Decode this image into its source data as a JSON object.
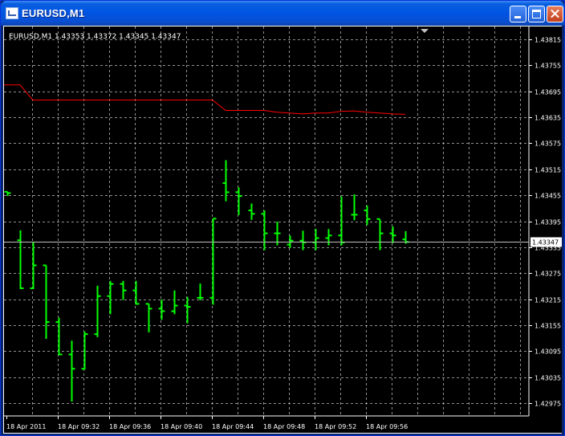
{
  "window": {
    "title": "EURUSD,M1",
    "icon": "chart-window-icon"
  },
  "colors": {
    "background": "#000000",
    "grid": "#c0c0c0",
    "bars": "#00ff00",
    "ma_line": "#ff0000",
    "ask_line": "#c0c0c0",
    "text": "#ffffff"
  },
  "chart_data": {
    "type": "ohlc",
    "header_text": "EURUSD,M1  1.43353 1.43372 1.43345 1.43347",
    "symbol": "EURUSD,M1",
    "ylim": [
      1.42945,
      1.43845
    ],
    "y_ticks": [
      1.43815,
      1.43755,
      1.43695,
      1.43635,
      1.43575,
      1.43515,
      1.43455,
      1.43395,
      1.43335,
      1.43275,
      1.43215,
      1.43155,
      1.43095,
      1.43035,
      1.42975
    ],
    "y_tick_labels": [
      "1.43815",
      "1.43755",
      "1.43695",
      "1.43635",
      "1.43575",
      "1.43515",
      "1.43455",
      "1.43395",
      "1.43335",
      "1.43275",
      "1.43215",
      "1.43155",
      "1.43095",
      "1.43035",
      "1.42975"
    ],
    "x_labels": [
      "18 Apr 2011",
      "18 Apr 09:32",
      "18 Apr 09:36",
      "18 Apr 09:40",
      "18 Apr 09:44",
      "18 Apr 09:48",
      "18 Apr 09:52",
      "18 Apr 09:56"
    ],
    "current_price": 1.43347,
    "current_price_label": "1.43347",
    "grid": true,
    "bars": [
      {
        "o": 1.43463,
        "h": 1.43463,
        "l": 1.43455,
        "c": 1.4346
      },
      {
        "o": 1.43351,
        "h": 1.43374,
        "l": 1.4324,
        "c": 1.4324
      },
      {
        "o": 1.4324,
        "h": 1.43346,
        "l": 1.4324,
        "c": 1.43293
      },
      {
        "o": 1.43293,
        "h": 1.43293,
        "l": 1.43125,
        "c": 1.43162
      },
      {
        "o": 1.43162,
        "h": 1.43172,
        "l": 1.43087,
        "c": 1.43087
      },
      {
        "o": 1.43087,
        "h": 1.43119,
        "l": 1.4298,
        "c": 1.43054
      },
      {
        "o": 1.43054,
        "h": 1.4314,
        "l": 1.43054,
        "c": 1.43134
      },
      {
        "o": 1.43134,
        "h": 1.43246,
        "l": 1.43129,
        "c": 1.43222
      },
      {
        "o": 1.43222,
        "h": 1.43257,
        "l": 1.43182,
        "c": 1.4325
      },
      {
        "o": 1.4325,
        "h": 1.43257,
        "l": 1.43215,
        "c": 1.43235
      },
      {
        "o": 1.43235,
        "h": 1.43257,
        "l": 1.43204,
        "c": 1.43204
      },
      {
        "o": 1.43204,
        "h": 1.43204,
        "l": 1.4314,
        "c": 1.43193
      },
      {
        "o": 1.43193,
        "h": 1.43214,
        "l": 1.43169,
        "c": 1.43187
      },
      {
        "o": 1.43187,
        "h": 1.43235,
        "l": 1.43182,
        "c": 1.432
      },
      {
        "o": 1.432,
        "h": 1.4322,
        "l": 1.43161,
        "c": 1.43197
      },
      {
        "o": 1.43218,
        "h": 1.43251,
        "l": 1.43214,
        "c": 1.43218
      },
      {
        "o": 1.43218,
        "h": 1.43401,
        "l": 1.43204,
        "c": 1.43401
      },
      {
        "o": 1.43483,
        "h": 1.43536,
        "l": 1.43443,
        "c": 1.43462
      },
      {
        "o": 1.43462,
        "h": 1.43473,
        "l": 1.43411,
        "c": 1.43453
      },
      {
        "o": 1.4342,
        "h": 1.43436,
        "l": 1.434,
        "c": 1.43412
      },
      {
        "o": 1.43412,
        "h": 1.4342,
        "l": 1.4333,
        "c": 1.43367
      },
      {
        "o": 1.43367,
        "h": 1.43394,
        "l": 1.43341,
        "c": 1.43367
      },
      {
        "o": 1.43341,
        "h": 1.43362,
        "l": 1.43335,
        "c": 1.4335
      },
      {
        "o": 1.4335,
        "h": 1.43373,
        "l": 1.4333,
        "c": 1.43346
      },
      {
        "o": 1.43346,
        "h": 1.43377,
        "l": 1.4333,
        "c": 1.43356
      },
      {
        "o": 1.43356,
        "h": 1.43377,
        "l": 1.43341,
        "c": 1.43362
      },
      {
        "o": 1.43362,
        "h": 1.43452,
        "l": 1.43341,
        "c": 1.43346
      },
      {
        "o": 1.4341,
        "h": 1.43457,
        "l": 1.43399,
        "c": 1.4341
      },
      {
        "o": 1.4342,
        "h": 1.43431,
        "l": 1.43388,
        "c": 1.434
      },
      {
        "o": 1.434,
        "h": 1.43399,
        "l": 1.4333,
        "c": 1.43367
      },
      {
        "o": 1.43367,
        "h": 1.43383,
        "l": 1.43346,
        "c": 1.43362
      },
      {
        "o": 1.43353,
        "h": 1.43372,
        "l": 1.43345,
        "c": 1.43347
      }
    ],
    "ma_series": [
      1.4371,
      1.4371,
      1.43675,
      1.43675,
      1.43675,
      1.43675,
      1.43675,
      1.43675,
      1.43675,
      1.43675,
      1.43675,
      1.43675,
      1.43675,
      1.43675,
      1.43675,
      1.43675,
      1.43675,
      1.43651,
      1.43651,
      1.43651,
      1.43651,
      1.43647,
      1.43645,
      1.43643,
      1.43645,
      1.43645,
      1.43649,
      1.4365,
      1.43647,
      1.43645,
      1.43643,
      1.43642
    ]
  }
}
